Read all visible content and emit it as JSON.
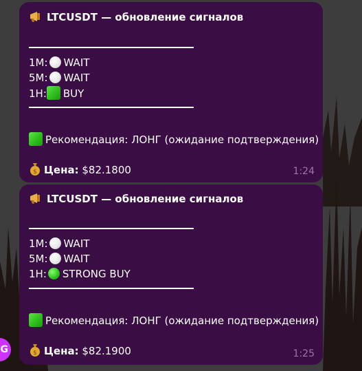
{
  "colors": {
    "bubble": "#3a0d45",
    "time": "#9b78a8",
    "accent": "#cc33ff"
  },
  "messages": [
    {
      "title": "LTCUSDT — обновление сигналов",
      "signals": [
        {
          "tf": "1M:",
          "status": "WAIT",
          "icon": "white-circle-icon"
        },
        {
          "tf": "5M:",
          "status": "WAIT",
          "icon": "white-circle-icon"
        },
        {
          "tf": "1H:",
          "status": "BUY",
          "icon": "green-square-icon"
        }
      ],
      "recommendation": "Рекомендация: ЛОНГ (ожидание подтверждения)",
      "price_label": "Цена:",
      "price_value": "$82.1800",
      "time": "1:24"
    },
    {
      "title": "LTCUSDT — обновление сигналов",
      "signals": [
        {
          "tf": "1M:",
          "status": "WAIT",
          "icon": "white-circle-icon"
        },
        {
          "tf": "5M:",
          "status": "WAIT",
          "icon": "white-circle-icon"
        },
        {
          "tf": "1H:",
          "status": "STRONG BUY",
          "icon": "green-circle-icon"
        }
      ],
      "recommendation": "Рекомендация: ЛОНГ (ожидание подтверждения)",
      "price_label": "Цена:",
      "price_value": "$82.1900",
      "time": "1:25"
    }
  ],
  "avatar": {
    "letter": "G"
  }
}
